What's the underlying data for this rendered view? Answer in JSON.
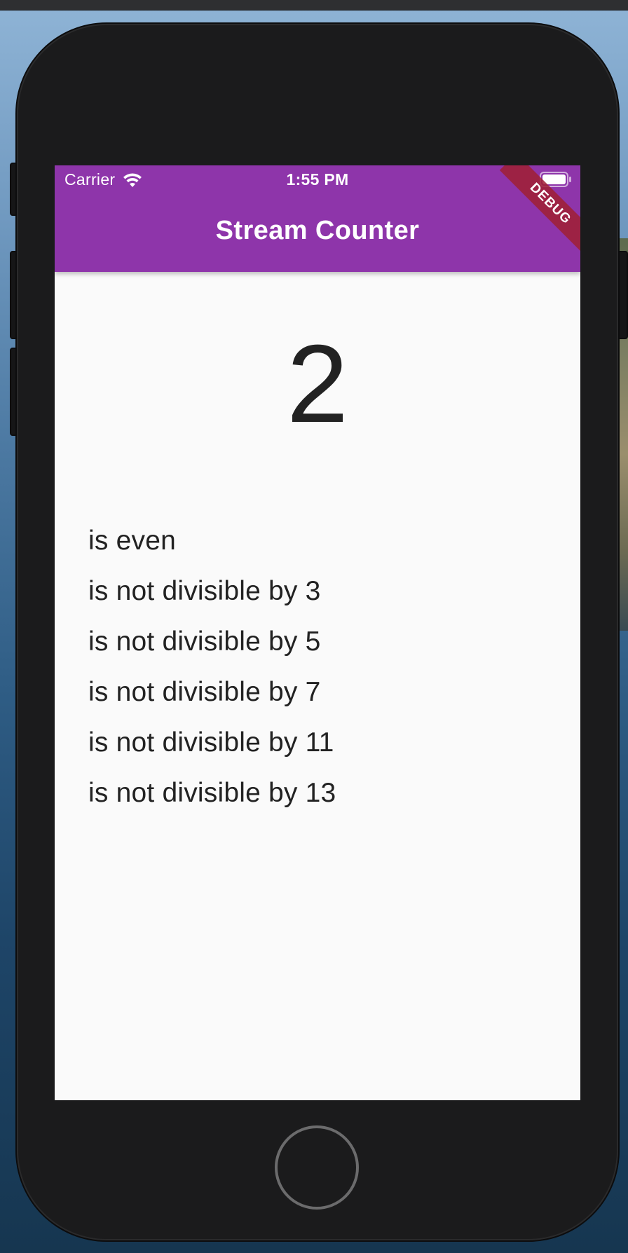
{
  "status_bar": {
    "carrier": "Carrier",
    "time": "1:55 PM",
    "wifi_icon": "wifi-icon",
    "battery_icon": "battery-full-icon"
  },
  "app_bar": {
    "title": "Stream Counter",
    "color": "#8e35aa"
  },
  "debug_banner": {
    "label": "DEBUG"
  },
  "counter": {
    "value": "2"
  },
  "facts": [
    "is even",
    "is not divisible by 3",
    "is not divisible by 5",
    "is not divisible by 7",
    "is not divisible by 11",
    "is not divisible by 13"
  ]
}
